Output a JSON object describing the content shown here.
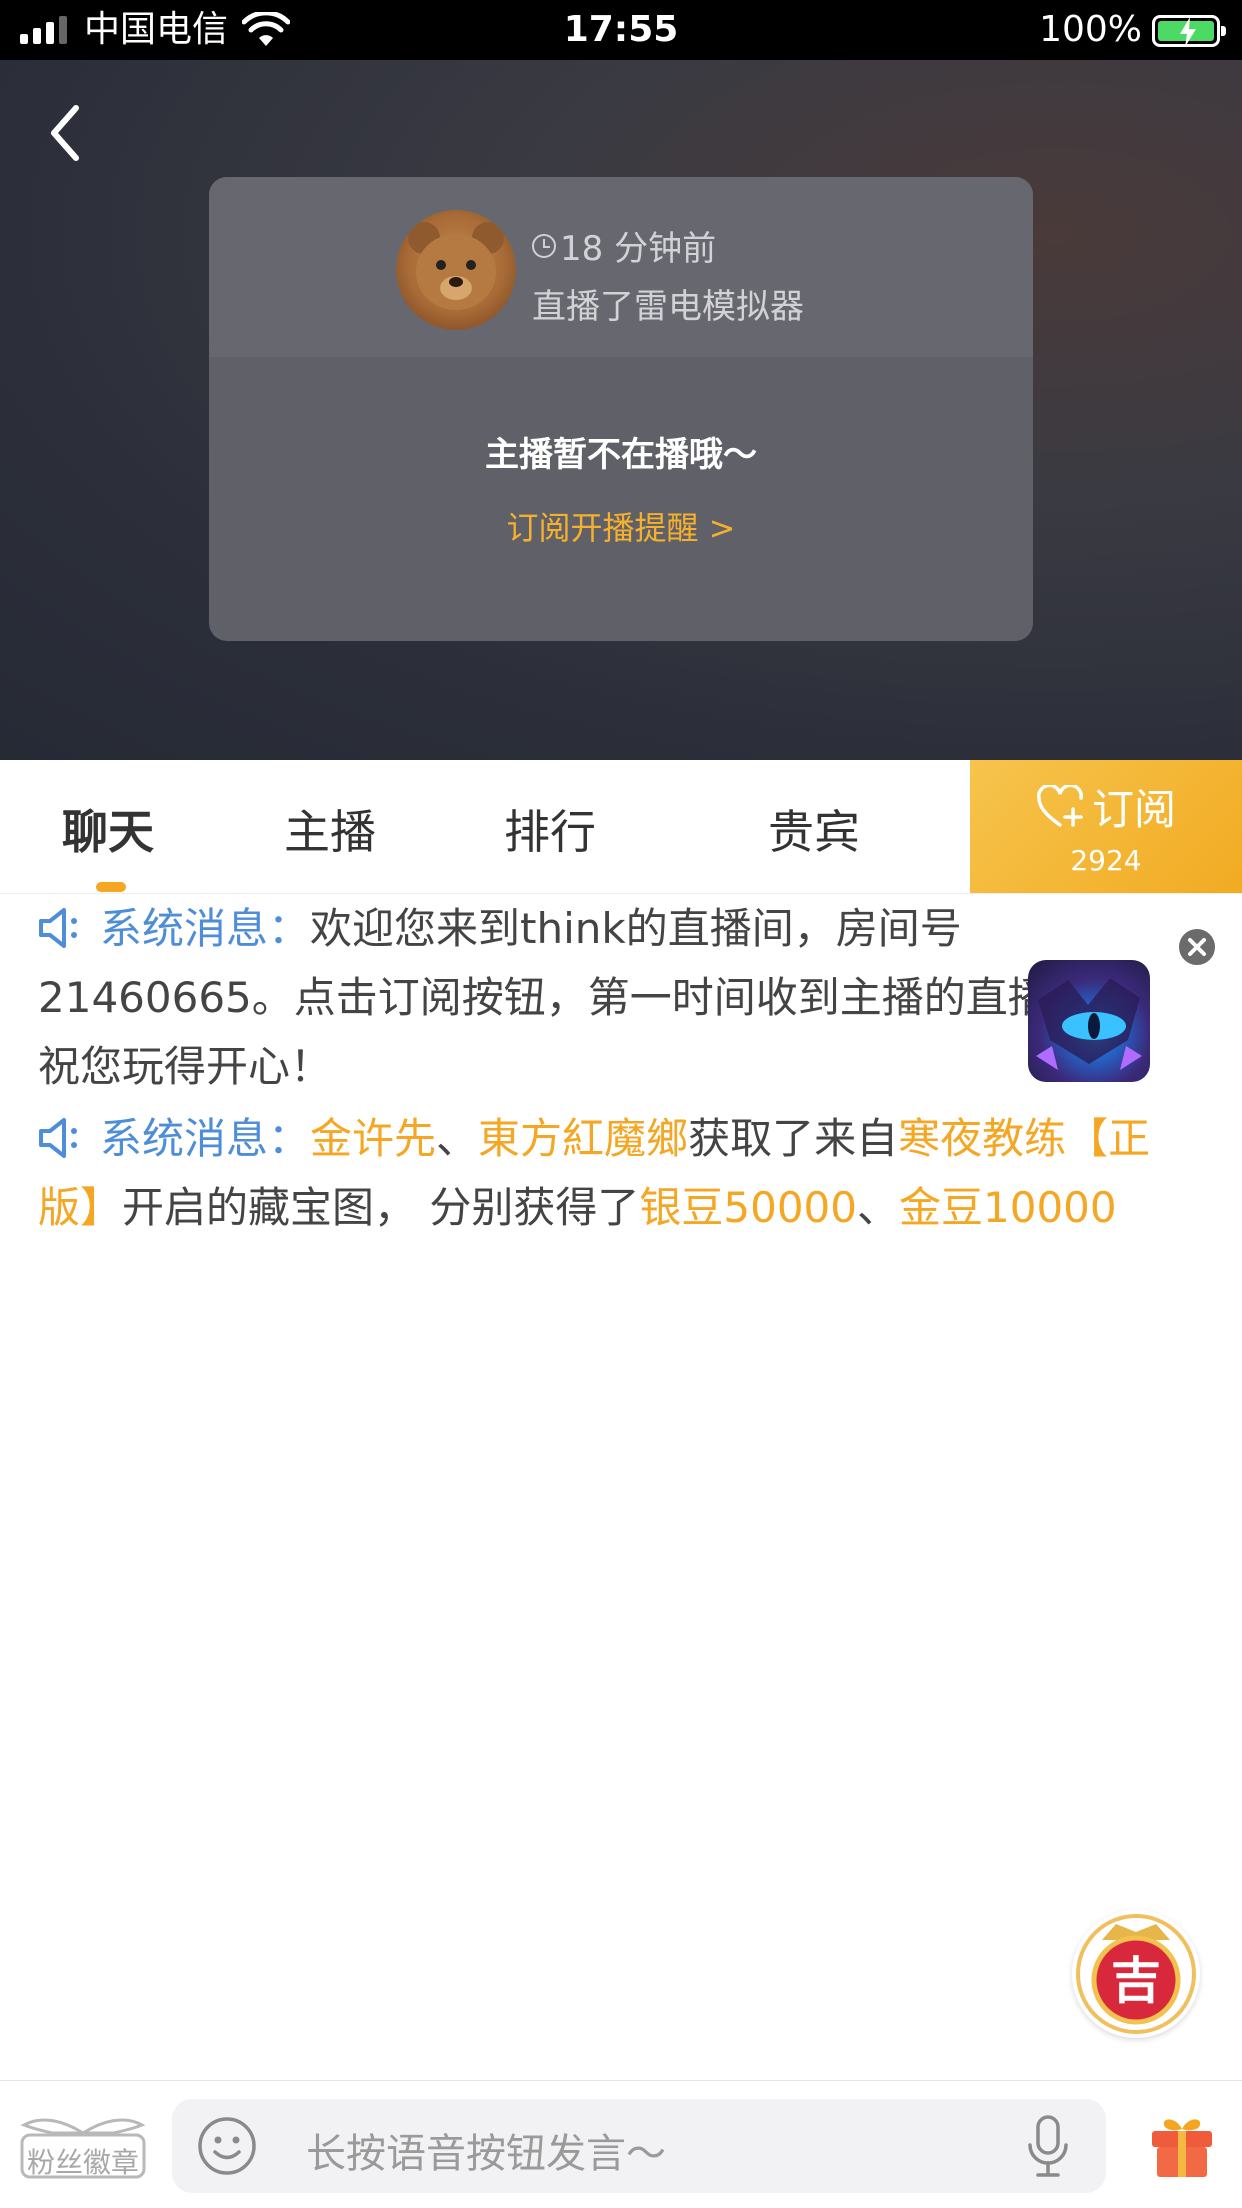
{
  "status_bar": {
    "carrier": "中国电信",
    "time": "17:55",
    "battery": "100%"
  },
  "player": {
    "time_ago": "18 分钟前",
    "streamed": "直播了雷电模拟器",
    "offline_text": "主播暂不在播哦～",
    "subscribe_remind": "订阅开播提醒 >"
  },
  "tabs": [
    {
      "label": "聊天",
      "active": true
    },
    {
      "label": "主播"
    },
    {
      "label": "排行"
    },
    {
      "label": "贵宾"
    }
  ],
  "subscribe": {
    "label": "订阅",
    "count": "2924"
  },
  "messages": [
    {
      "prefix": "系统消息：",
      "text": "欢迎您来到think的直播间，房间号21460665。点击订阅按钮，第一时间收到主播的直播通知，祝您玩得开心！"
    },
    {
      "prefix": "系统消息：",
      "user1": "金许先",
      "sep1": "、",
      "user2": "東方紅魔鄉",
      "mid": "获取了来自",
      "source": "寒夜教练【正版】",
      "mid2": "开启的藏宝图， 分别获得了",
      "reward1": "银豆50000",
      "sep2": "、",
      "reward2": "金豆10000"
    }
  ],
  "bottom_bar": {
    "fan_badge": "粉丝徽章",
    "placeholder": "长按语音按钮发言～"
  },
  "lucky_badge": "吉",
  "colors": {
    "accent": "#f5a623",
    "system": "#4e8ed8"
  }
}
